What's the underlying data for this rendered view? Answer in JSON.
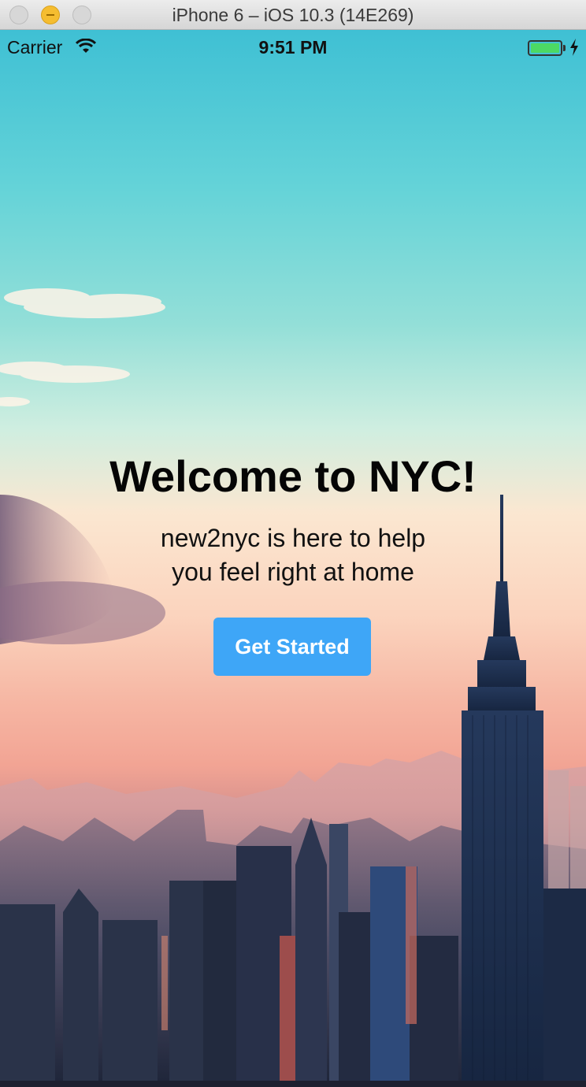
{
  "window": {
    "title": "iPhone 6 – iOS 10.3 (14E269)"
  },
  "status_bar": {
    "carrier": "Carrier",
    "time": "9:51 PM",
    "battery_level": 1.0,
    "charging": true
  },
  "main": {
    "title": "Welcome to NYC!",
    "subtitle_lines": [
      "new2nyc is here to help",
      "you feel right at home"
    ],
    "cta_label": "Get Started"
  },
  "colors": {
    "button": "#3ea6f7",
    "battery": "#4cd964",
    "sky_top": "#3fc0d4",
    "sky_glow": "#fbd3bd"
  },
  "icons": [
    "wifi-icon",
    "charging-bolt-icon"
  ]
}
